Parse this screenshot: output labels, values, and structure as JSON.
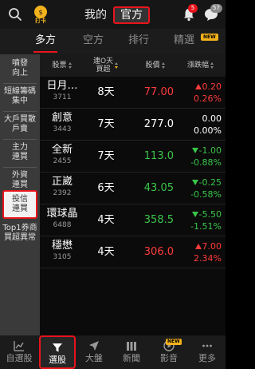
{
  "header": {
    "logo_text": "打卡",
    "segments": [
      {
        "label": "我的",
        "active": false
      },
      {
        "label": "官方",
        "active": true
      }
    ],
    "bell_badge": "5",
    "chat_badge": "57"
  },
  "tabs": [
    {
      "label": "多方",
      "active": true
    },
    {
      "label": "空方",
      "active": false
    },
    {
      "label": "排行",
      "active": false
    },
    {
      "label": "精選",
      "active": false,
      "badge": "NEW"
    }
  ],
  "side_menu": [
    {
      "lines": [
        "噴發",
        "向上"
      ],
      "active": false
    },
    {
      "lines": [
        "短線籌碼",
        "集中"
      ],
      "active": false
    },
    {
      "lines": [
        "大戶買散",
        "戶賣"
      ],
      "active": false
    },
    {
      "lines": [
        "主力",
        "連買"
      ],
      "active": false
    },
    {
      "lines": [
        "外資",
        "連買"
      ],
      "active": false
    },
    {
      "lines": [
        "投信",
        "連買"
      ],
      "active": true
    },
    {
      "lines": [
        "Top1券商",
        "買超異常"
      ],
      "active": false
    }
  ],
  "table": {
    "headers": {
      "stock": "股票",
      "days_line1": "連O天",
      "days_line2": "買超",
      "price": "股價",
      "change": "漲跌幅"
    },
    "rows": [
      {
        "name": "日月…",
        "code": "3711",
        "days": "8天",
        "price": "77.00",
        "chg": "0.20",
        "pct": "0.26%",
        "dir": "up"
      },
      {
        "name": "創意",
        "code": "3443",
        "days": "7天",
        "price": "277.0",
        "chg": "0.00",
        "pct": "0.00%",
        "dir": "flat"
      },
      {
        "name": "全新",
        "code": "2455",
        "days": "7天",
        "price": "113.0",
        "chg": "-1.00",
        "pct": "-0.88%",
        "dir": "down"
      },
      {
        "name": "正崴",
        "code": "2392",
        "days": "6天",
        "price": "43.05",
        "chg": "-0.25",
        "pct": "-0.58%",
        "dir": "down"
      },
      {
        "name": "環球晶",
        "code": "6488",
        "days": "4天",
        "price": "358.5",
        "chg": "-5.50",
        "pct": "-1.51%",
        "dir": "down"
      },
      {
        "name": "穩懋",
        "code": "3105",
        "days": "4天",
        "price": "306.0",
        "chg": "7.00",
        "pct": "2.34%",
        "dir": "up"
      }
    ]
  },
  "bottom_nav": [
    {
      "label": "自選股",
      "icon": "chart-icon",
      "active": false
    },
    {
      "label": "選股",
      "icon": "filter-icon",
      "active": true
    },
    {
      "label": "大盤",
      "icon": "send-icon",
      "active": false
    },
    {
      "label": "新聞",
      "icon": "news-icon",
      "active": false
    },
    {
      "label": "影音",
      "icon": "video-icon",
      "active": false,
      "badge": "NEW"
    },
    {
      "label": "更多",
      "icon": "more-icon",
      "active": false
    }
  ],
  "colors": {
    "accent": "#e8141c",
    "up": "#ff3b3b",
    "down": "#3ac44a",
    "highlight": "#f2b21c"
  }
}
